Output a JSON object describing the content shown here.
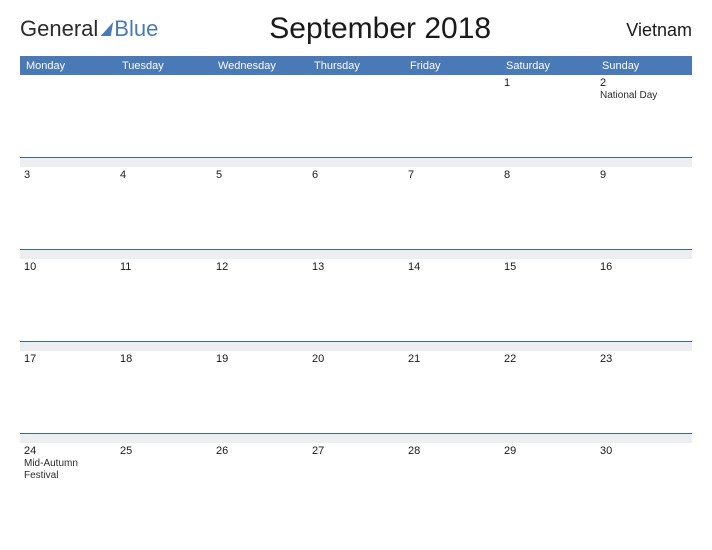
{
  "brand": {
    "part1": "General",
    "part2": "Blue"
  },
  "title": "September 2018",
  "country": "Vietnam",
  "daynames": [
    "Monday",
    "Tuesday",
    "Wednesday",
    "Thursday",
    "Friday",
    "Saturday",
    "Sunday"
  ],
  "weeks": [
    [
      {
        "num": "",
        "event": ""
      },
      {
        "num": "",
        "event": ""
      },
      {
        "num": "",
        "event": ""
      },
      {
        "num": "",
        "event": ""
      },
      {
        "num": "",
        "event": ""
      },
      {
        "num": "1",
        "event": ""
      },
      {
        "num": "2",
        "event": "National Day"
      }
    ],
    [
      {
        "num": "3",
        "event": ""
      },
      {
        "num": "4",
        "event": ""
      },
      {
        "num": "5",
        "event": ""
      },
      {
        "num": "6",
        "event": ""
      },
      {
        "num": "7",
        "event": ""
      },
      {
        "num": "8",
        "event": ""
      },
      {
        "num": "9",
        "event": ""
      }
    ],
    [
      {
        "num": "10",
        "event": ""
      },
      {
        "num": "11",
        "event": ""
      },
      {
        "num": "12",
        "event": ""
      },
      {
        "num": "13",
        "event": ""
      },
      {
        "num": "14",
        "event": ""
      },
      {
        "num": "15",
        "event": ""
      },
      {
        "num": "16",
        "event": ""
      }
    ],
    [
      {
        "num": "17",
        "event": ""
      },
      {
        "num": "18",
        "event": ""
      },
      {
        "num": "19",
        "event": ""
      },
      {
        "num": "20",
        "event": ""
      },
      {
        "num": "21",
        "event": ""
      },
      {
        "num": "22",
        "event": ""
      },
      {
        "num": "23",
        "event": ""
      }
    ],
    [
      {
        "num": "24",
        "event": "Mid-Autumn Festival"
      },
      {
        "num": "25",
        "event": ""
      },
      {
        "num": "26",
        "event": ""
      },
      {
        "num": "27",
        "event": ""
      },
      {
        "num": "28",
        "event": ""
      },
      {
        "num": "29",
        "event": ""
      },
      {
        "num": "30",
        "event": ""
      }
    ]
  ]
}
